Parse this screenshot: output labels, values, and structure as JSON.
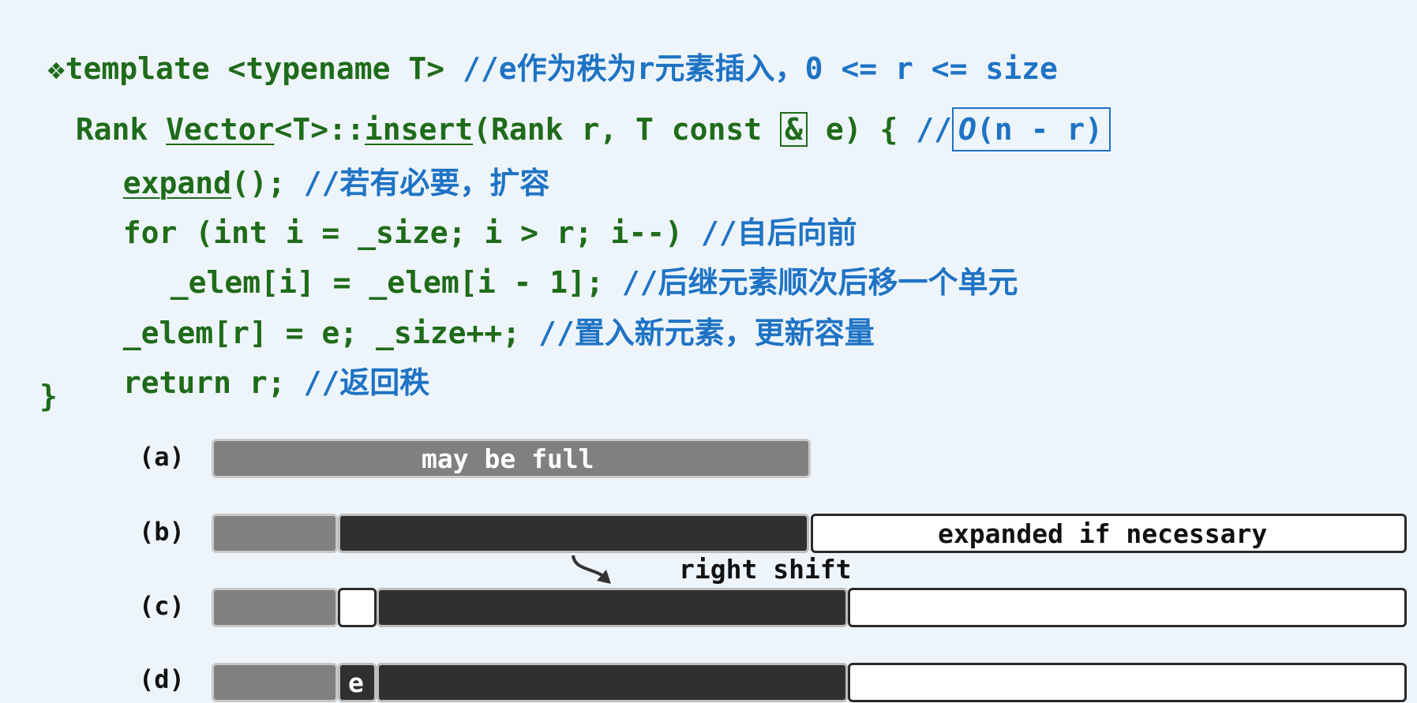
{
  "code": {
    "bullet": "❖",
    "line1_code": "template <typename T>",
    "line1_comment_slashes": "//",
    "line1_comment_e": "e",
    "line1_comment_zh": "作为秩为",
    "line1_comment_r": "r",
    "line1_comment_zh2": "元素插入，",
    "line1_comment_tail": "0 <= r <= size",
    "line2_rank": "Rank ",
    "line2_vector": "Vector",
    "line2_mid": "<T>::",
    "line2_insert": "insert",
    "line2_args": "(Rank r, T const ",
    "line2_amp": "&",
    "line2_after": " e) { ",
    "line2_slashes": "//",
    "line2_bigO": "O",
    "line2_complexity": "(n - r)",
    "line3_expand": "expand",
    "line3_rest": "(); ",
    "line3_comment": "//若有必要，扩容",
    "line4_code": "for (int i = _size; i > r; i--) ",
    "line4_comment": "//自后向前",
    "line5_code": "_elem[i] = _elem[i - 1]; ",
    "line5_comment": "//后继元素顺次后移一个单元",
    "line6_code": "_elem[r] = e; _size++; ",
    "line6_comment": "//置入新元素，更新容量",
    "line7_code": "return r; ",
    "line7_comment": "//返回秩",
    "close_brace": "}"
  },
  "diagram": {
    "row_a_label": "(a)",
    "row_a_text": "may be full",
    "row_b_label": "(b)",
    "row_b_text": "expanded if necessary",
    "shift_text": "right shift",
    "row_c_label": "(c)",
    "row_d_label": "(d)",
    "row_d_elem": "e"
  },
  "colors": {
    "code_green": "#1f6b1a",
    "comment_blue": "#1f73c4",
    "prefix_gray": "#808080",
    "suffix_black": "#303030",
    "background": "#eef5fa"
  }
}
